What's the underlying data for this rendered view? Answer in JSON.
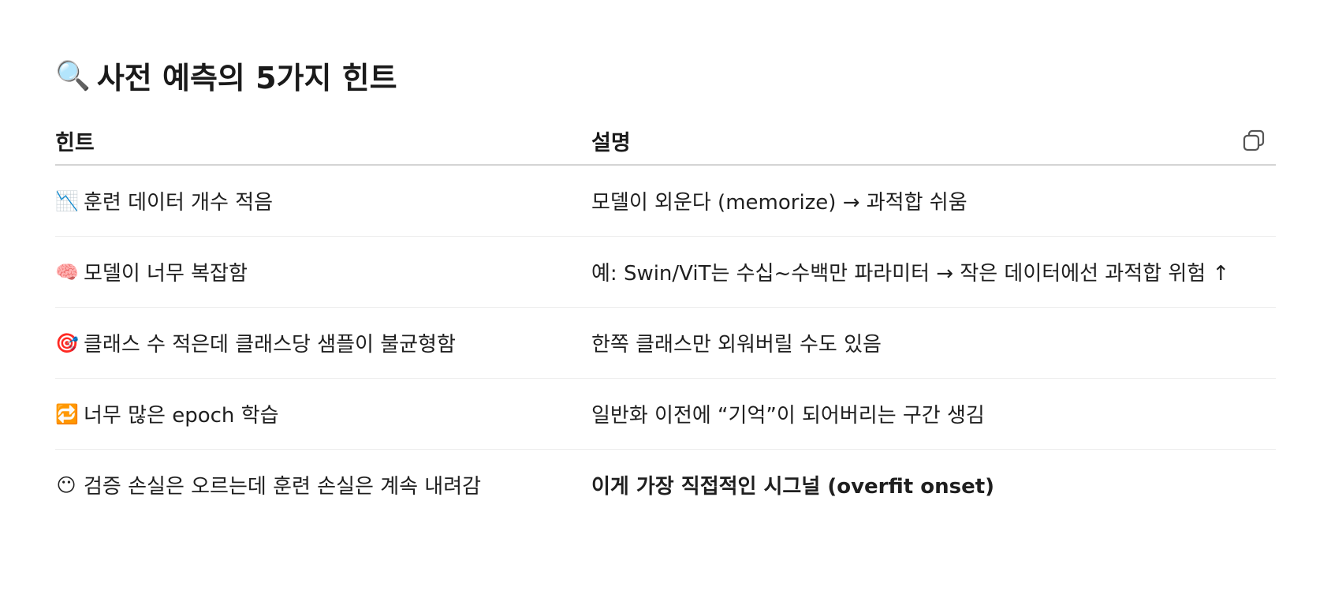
{
  "heading": {
    "emoji": "🔍",
    "title": "사전 예측의 5가지 힌트"
  },
  "table": {
    "headers": [
      "힌트",
      "설명"
    ],
    "copy_icon": "copy-icon",
    "rows": [
      {
        "emoji": "📉",
        "hint": "훈련 데이터 개수 적음",
        "desc": "모델이 외운다 (memorize) → 과적합 쉬움",
        "desc_bold": false
      },
      {
        "emoji": "🧠",
        "hint": "모델이 너무 복잡함",
        "desc": "예: Swin/ViT는 수십~수백만 파라미터 → 작은 데이터에선 과적합 위험 ↑",
        "desc_bold": false
      },
      {
        "emoji": "🎯",
        "hint": "클래스 수 적은데 클래스당 샘플이 불균형함",
        "desc": "한쪽 클래스만 외워버릴 수도 있음",
        "desc_bold": false
      },
      {
        "emoji": "🔁",
        "hint": "너무 많은 epoch 학습",
        "desc": "일반화 이전에 “기억”이 되어버리는 구간 생김",
        "desc_bold": false
      },
      {
        "emoji": "😶",
        "hint": "검증 손실은 오르는데 훈련 손실은 계속 내려감",
        "desc": "이게 가장 직접적인 시그널 (overfit onset)",
        "desc_bold": true
      }
    ]
  }
}
